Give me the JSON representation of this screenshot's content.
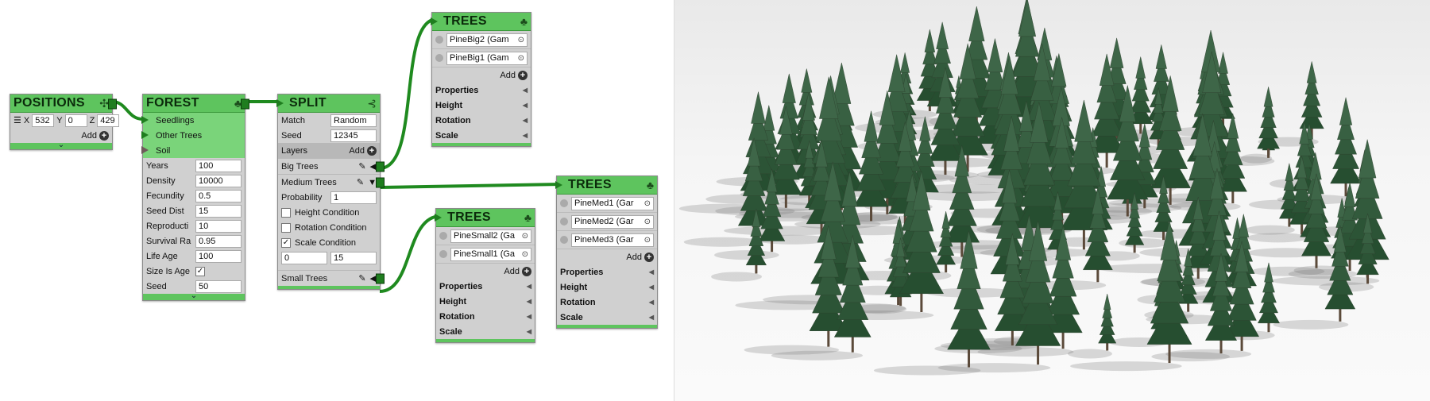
{
  "positions_node": {
    "title": "POSITIONS",
    "x_label": "X",
    "x_value": "532",
    "y_label": "Y",
    "y_value": "0",
    "z_label": "Z",
    "z_value": "429",
    "add_label": "Add"
  },
  "forest_node": {
    "title": "FOREST",
    "inputs": [
      "Seedlings",
      "Other Trees",
      "Soil"
    ],
    "fields": [
      {
        "label": "Years",
        "value": "100"
      },
      {
        "label": "Density",
        "value": "10000"
      },
      {
        "label": "Fecundity",
        "value": "0.5"
      },
      {
        "label": "Seed Dist",
        "value": "15"
      },
      {
        "label": "Reproducti",
        "value": "10"
      },
      {
        "label": "Survival Ra",
        "value": "0.95"
      },
      {
        "label": "Life Age",
        "value": "100"
      },
      {
        "label": "Size Is Age",
        "value": "✓"
      },
      {
        "label": "Seed",
        "value": "50"
      }
    ]
  },
  "split_node": {
    "title": "SPLIT",
    "match_label": "Match",
    "match_value": "Random",
    "seed_label": "Seed",
    "seed_value": "12345",
    "layers_label": "Layers",
    "add_label": "Add",
    "layers": [
      "Big Trees",
      "Medium Trees",
      "Small Trees"
    ],
    "probability_label": "Probability",
    "probability_value": "1",
    "conditions": [
      {
        "label": "Height Condition",
        "checked": ""
      },
      {
        "label": "Rotation Condition",
        "checked": ""
      },
      {
        "label": "Scale Condition",
        "checked": "✓"
      }
    ],
    "range_min": "0",
    "range_max": "15"
  },
  "trees_big": {
    "title": "TREES",
    "objects": [
      "PineBig2 (Gam",
      "PineBig1 (Gam"
    ],
    "add_label": "Add",
    "props": [
      "Properties",
      "Height",
      "Rotation",
      "Scale"
    ]
  },
  "trees_med": {
    "title": "TREES",
    "objects": [
      "PineMed1 (Gar",
      "PineMed2 (Gar",
      "PineMed3 (Gar"
    ],
    "add_label": "Add",
    "props": [
      "Properties",
      "Height",
      "Rotation",
      "Scale"
    ]
  },
  "trees_small": {
    "title": "TREES",
    "objects": [
      "PineSmall2 (Ga",
      "PineSmall1 (Ga"
    ],
    "add_label": "Add",
    "props": [
      "Properties",
      "Height",
      "Rotation",
      "Scale"
    ]
  },
  "colors": {
    "node_header": "#5ec45e",
    "wire": "#1f8a1f",
    "node_body": "#d0d0d0"
  },
  "icons": [
    "tree-icon",
    "grid-icon",
    "split-icon",
    "add-icon",
    "pencil-icon",
    "chevron-down-icon"
  ]
}
